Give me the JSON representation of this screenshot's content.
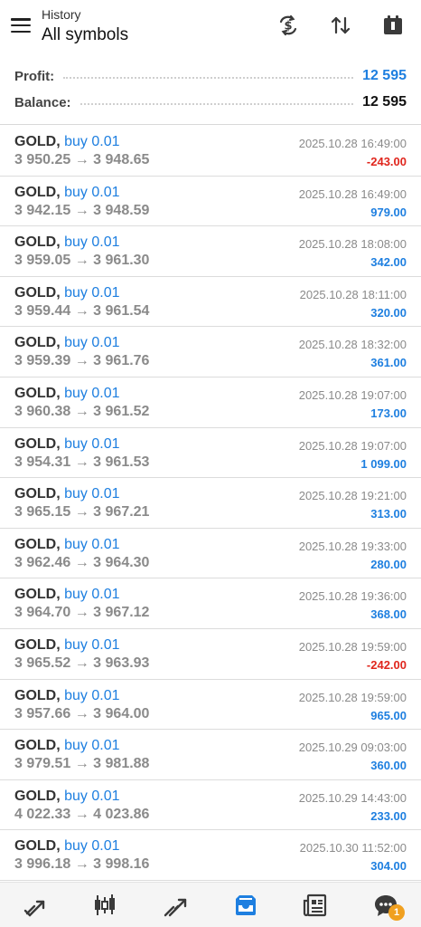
{
  "header": {
    "subtitle": "History",
    "title": "All symbols",
    "icons": [
      "menu-icon",
      "currency-exchange-icon",
      "sort-icon",
      "calendar-icon"
    ]
  },
  "summary": {
    "profit_label": "Profit:",
    "profit_value": "12 595",
    "balance_label": "Balance:",
    "balance_value": "12 595"
  },
  "trades": [
    {
      "symbol": "GOLD,",
      "side": "buy 0.01",
      "prices": "3 950.25 → 3 948.65",
      "time": "2025.10.28 16:49:00",
      "profit": "-243.00",
      "negative": true
    },
    {
      "symbol": "GOLD,",
      "side": "buy 0.01",
      "prices": "3 942.15 → 3 948.59",
      "time": "2025.10.28 16:49:00",
      "profit": "979.00",
      "negative": false
    },
    {
      "symbol": "GOLD,",
      "side": "buy 0.01",
      "prices": "3 959.05 → 3 961.30",
      "time": "2025.10.28 18:08:00",
      "profit": "342.00",
      "negative": false
    },
    {
      "symbol": "GOLD,",
      "side": "buy 0.01",
      "prices": "3 959.44 → 3 961.54",
      "time": "2025.10.28 18:11:00",
      "profit": "320.00",
      "negative": false
    },
    {
      "symbol": "GOLD,",
      "side": "buy 0.01",
      "prices": "3 959.39 → 3 961.76",
      "time": "2025.10.28 18:32:00",
      "profit": "361.00",
      "negative": false
    },
    {
      "symbol": "GOLD,",
      "side": "buy 0.01",
      "prices": "3 960.38 → 3 961.52",
      "time": "2025.10.28 19:07:00",
      "profit": "173.00",
      "negative": false
    },
    {
      "symbol": "GOLD,",
      "side": "buy 0.01",
      "prices": "3 954.31 → 3 961.53",
      "time": "2025.10.28 19:07:00",
      "profit": "1 099.00",
      "negative": false
    },
    {
      "symbol": "GOLD,",
      "side": "buy 0.01",
      "prices": "3 965.15 → 3 967.21",
      "time": "2025.10.28 19:21:00",
      "profit": "313.00",
      "negative": false
    },
    {
      "symbol": "GOLD,",
      "side": "buy 0.01",
      "prices": "3 962.46 → 3 964.30",
      "time": "2025.10.28 19:33:00",
      "profit": "280.00",
      "negative": false
    },
    {
      "symbol": "GOLD,",
      "side": "buy 0.01",
      "prices": "3 964.70 → 3 967.12",
      "time": "2025.10.28 19:36:00",
      "profit": "368.00",
      "negative": false
    },
    {
      "symbol": "GOLD,",
      "side": "buy 0.01",
      "prices": "3 965.52 → 3 963.93",
      "time": "2025.10.28 19:59:00",
      "profit": "-242.00",
      "negative": true
    },
    {
      "symbol": "GOLD,",
      "side": "buy 0.01",
      "prices": "3 957.66 → 3 964.00",
      "time": "2025.10.28 19:59:00",
      "profit": "965.00",
      "negative": false
    },
    {
      "symbol": "GOLD,",
      "side": "buy 0.01",
      "prices": "3 979.51 → 3 981.88",
      "time": "2025.10.29 09:03:00",
      "profit": "360.00",
      "negative": false
    },
    {
      "symbol": "GOLD,",
      "side": "buy 0.01",
      "prices": "4 022.33 → 4 023.86",
      "time": "2025.10.29 14:43:00",
      "profit": "233.00",
      "negative": false
    },
    {
      "symbol": "GOLD,",
      "side": "buy 0.01",
      "prices": "3 996.18 → 3 998.16",
      "time": "2025.10.30 11:52:00",
      "profit": "304.00",
      "negative": false
    }
  ],
  "bottom_nav": {
    "items": [
      "quotes-icon",
      "chart-icon",
      "trade-icon",
      "history-icon",
      "news-icon",
      "messages-icon"
    ],
    "active": "history-icon",
    "messages_badge": "1"
  },
  "colors": {
    "accent": "#1e7fe0",
    "negative": "#e0261d",
    "badge": "#f0a020",
    "icon": "#3a3a3a"
  }
}
